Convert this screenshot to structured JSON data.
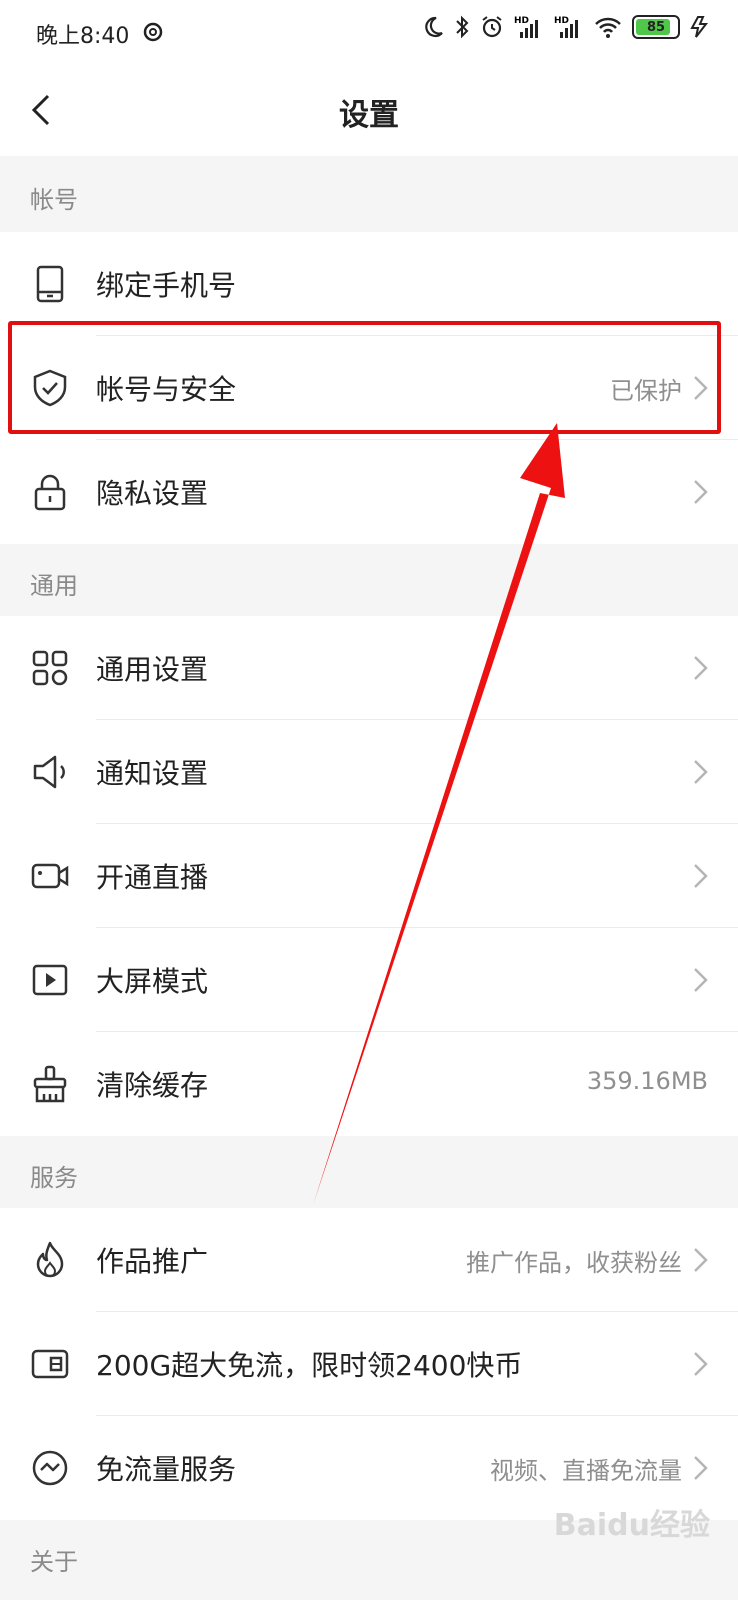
{
  "status": {
    "time": "晚上8:40",
    "battery": "85"
  },
  "nav": {
    "title": "设置"
  },
  "sections": {
    "account": "帐号",
    "general": "通用",
    "service": "服务",
    "about": "关于"
  },
  "rows": {
    "bind_phone": {
      "label": "绑定手机号",
      "icon": "phone-icon"
    },
    "account_security": {
      "label": "帐号与安全",
      "value": "已保护",
      "icon": "shield-icon"
    },
    "privacy": {
      "label": "隐私设置",
      "icon": "lock-icon"
    },
    "general_settings": {
      "label": "通用设置",
      "icon": "grid-icon"
    },
    "notification": {
      "label": "通知设置",
      "icon": "speaker-icon"
    },
    "live": {
      "label": "开通直播",
      "icon": "camera-icon"
    },
    "big_screen": {
      "label": "大屏模式",
      "icon": "play-icon"
    },
    "clear_cache": {
      "label": "清除缓存",
      "value": "359.16MB",
      "icon": "broom-icon"
    },
    "promotion": {
      "label": "作品推广",
      "value": "推广作品，收获粉丝",
      "icon": "flame-icon"
    },
    "free_data_offer": {
      "label": "200G超大免流，限时领2400快币",
      "icon": "sim-card-icon"
    },
    "free_data_service": {
      "label": "免流量服务",
      "value": "视频、直播免流量",
      "icon": "gauge-icon"
    }
  },
  "watermark": "Baidu经验",
  "colors": {
    "highlight": "#e01010",
    "section_bg": "#f5f5f5",
    "secondary_text": "#8f8f8f"
  }
}
